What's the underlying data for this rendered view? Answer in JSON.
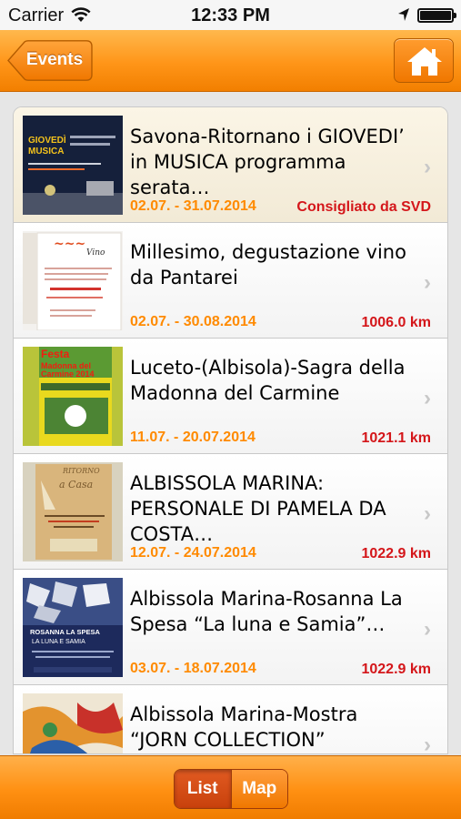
{
  "status": {
    "carrier": "Carrier",
    "time": "12:33 PM"
  },
  "nav": {
    "back_label": "Events",
    "home_icon": "house-icon"
  },
  "events": [
    {
      "title": "Savona-Ritornano i GIOVEDI’ in MUSICA programma serata…",
      "dates": "02.07. - 31.07.2014",
      "right": "Consigliato da SVD",
      "featured": true
    },
    {
      "title": "Millesimo, degustazione vino da Pantarei",
      "dates": "02.07. - 30.08.2014",
      "right": "1006.0 km",
      "featured": false
    },
    {
      "title": "Luceto-(Albisola)-Sagra della Madonna del Carmine",
      "dates": "11.07. - 20.07.2014",
      "right": "1021.1 km",
      "featured": false
    },
    {
      "title": "ALBISSOLA MARINA: PERSONALE DI PAMELA DA COSTA…",
      "dates": "12.07. - 24.07.2014",
      "right": "1022.9 km",
      "featured": false
    },
    {
      "title": "Albissola Marina-Rosanna La Spesa “La luna e Samia”…",
      "dates": "03.07. - 18.07.2014",
      "right": "1022.9 km",
      "featured": false
    },
    {
      "title": "Albissola Marina-Mostra “JORN COLLECTION”",
      "dates": "",
      "right": "",
      "featured": false
    }
  ],
  "thumbs": {
    "t0": {
      "line1": "GIOVEDÌ",
      "line2": "MUSICA"
    },
    "t1": {
      "line1": "Vino"
    },
    "t2": {
      "line1": "Festa",
      "line2": "Madonna del",
      "line3": "Carmine 2014"
    },
    "t3": {
      "line1": "RITORNO",
      "line2": "a Casa"
    },
    "t4": {
      "line1": "ROSANNA LA SPESA",
      "line2": "LA LUNA E SAMIA"
    }
  },
  "tabs": {
    "list_label": "List",
    "map_label": "Map",
    "selected": "List"
  },
  "colors": {
    "accent": "#ff9518",
    "date": "#ff8a00",
    "distance": "#d4161a"
  }
}
